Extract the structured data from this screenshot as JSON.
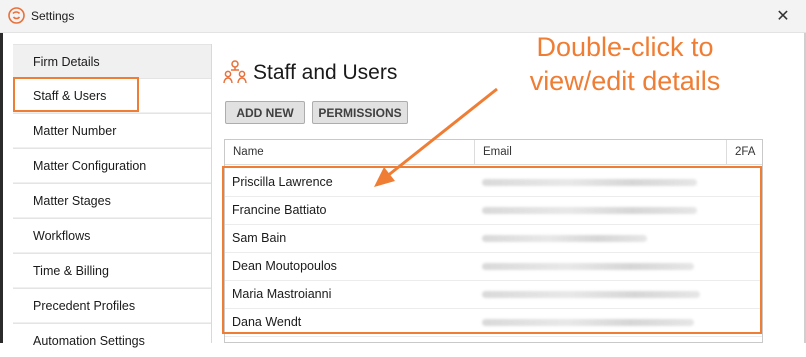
{
  "window": {
    "title": "Settings",
    "close_glyph": "✕",
    "app_icon": "app-logo-icon"
  },
  "sidebar": {
    "items": [
      {
        "label": "Firm Details"
      },
      {
        "label": "Staff & Users",
        "selected": true
      },
      {
        "label": "Matter Number"
      },
      {
        "label": "Matter Configuration"
      },
      {
        "label": "Matter Stages"
      },
      {
        "label": "Workflows"
      },
      {
        "label": "Time & Billing"
      },
      {
        "label": "Precedent Profiles"
      },
      {
        "label": "Automation Settings"
      }
    ]
  },
  "main": {
    "title": "Staff and Users",
    "icon": "staff-users-icon",
    "buttons": {
      "add_new": "ADD NEW",
      "permissions": "PERMISSIONS"
    },
    "table": {
      "columns": [
        "Name",
        "Email",
        "2FA"
      ],
      "rows": [
        {
          "name": "Priscilla Lawrence"
        },
        {
          "name": "Francine Battiato"
        },
        {
          "name": "Sam Bain"
        },
        {
          "name": "Dean Moutopoulos"
        },
        {
          "name": "Maria Mastroianni"
        },
        {
          "name": "Dana Wendt"
        }
      ]
    }
  },
  "annotation": {
    "line1": "Double-click to",
    "line2": "view/edit details",
    "color": "#ef7d34"
  }
}
